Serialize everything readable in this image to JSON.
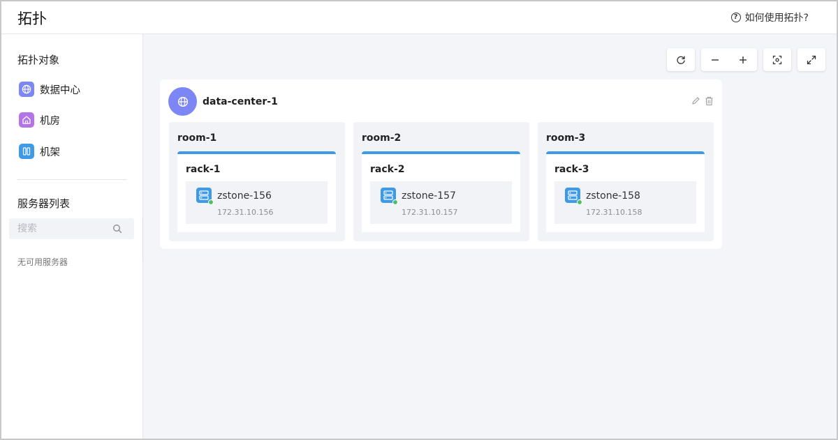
{
  "header": {
    "title": "拓扑",
    "help_label": "如何使用拓扑?",
    "help_icon": "question-circle-icon"
  },
  "sidebar": {
    "objects_title": "拓扑对象",
    "objects": [
      {
        "label": "数据中心",
        "icon": "globe-icon",
        "color": "#7c86f5"
      },
      {
        "label": "机房",
        "icon": "house-icon",
        "color": "#b374e8"
      },
      {
        "label": "机架",
        "icon": "rack-icon",
        "color": "#3d9ae8"
      }
    ],
    "servers_title": "服务器列表",
    "search": {
      "placeholder": "搜索",
      "icon": "search-icon"
    },
    "empty_text": "无可用服务器"
  },
  "toolbar": {
    "refresh_icon": "refresh-icon",
    "zoom_out_icon": "minus-icon",
    "zoom_in_icon": "plus-icon",
    "fit_icon": "focus-icon",
    "fullscreen_icon": "expand-icon"
  },
  "topology": {
    "data_center": {
      "name": "data-center-1",
      "icon": "globe-icon",
      "color": "#7c86f5"
    },
    "rooms": [
      {
        "name": "room-1",
        "rack": {
          "name": "rack-1",
          "server": {
            "name": "zstone-156",
            "ip": "172.31.10.156",
            "status": "online"
          }
        }
      },
      {
        "name": "room-2",
        "rack": {
          "name": "rack-2",
          "server": {
            "name": "zstone-157",
            "ip": "172.31.10.157",
            "status": "online"
          }
        }
      },
      {
        "name": "room-3",
        "rack": {
          "name": "rack-3",
          "server": {
            "name": "zstone-158",
            "ip": "172.31.10.158",
            "status": "online"
          }
        }
      }
    ]
  },
  "colors": {
    "accent": "#3d9ae8",
    "online": "#4cc16b",
    "canvas_bg": "#f4f5f9"
  }
}
